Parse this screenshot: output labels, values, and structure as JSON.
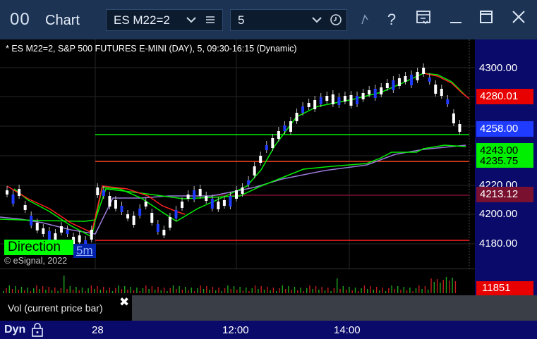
{
  "window": {
    "logo": "00",
    "title": "Chart",
    "symbol_value": "ES M22=2",
    "interval_value": "5",
    "buttons": [
      "bookmark-icon",
      "help-icon",
      "template-icon",
      "minimize-icon",
      "maximize-icon",
      "close-icon"
    ]
  },
  "chart": {
    "title": "* ES M22=2, S&P 500 FUTURES E-MINI (DAY), 5, 09:30-16:15 (Dynamic)",
    "direction_label": "Direction",
    "direction_tail": "5m",
    "copyright": "© eSignal, 2022",
    "colors": {
      "up_candle": "#ffffff",
      "down_candle": "#1f3bff",
      "red_line": "#ff2020",
      "green_line": "#00ee00",
      "purple_line": "#9a7ad8",
      "maroon_line": "#7a1030"
    }
  },
  "price_axis": {
    "ticks": [
      "4300.00",
      "4220.00",
      "4200.00",
      "4180.00"
    ],
    "tags": [
      {
        "label": "4280.01",
        "bg": "#e80000",
        "fg": "#ffffff"
      },
      {
        "label": "4258.00",
        "bg": "#1f3bff",
        "fg": "#ffffff"
      },
      {
        "label": "4235.75",
        "bg": "#00ee00",
        "fg": "#000000"
      },
      {
        "label": "4243.00",
        "bg": "#00ee00",
        "fg": "#000000"
      },
      {
        "label": "4213.12",
        "bg": "#7a1030",
        "fg": "#ffffff"
      }
    ]
  },
  "volume": {
    "caption": "Vol (current price bar)",
    "last": "11851"
  },
  "time_axis": {
    "mode": "Dyn",
    "ticks": [
      "28",
      "12:00",
      "14:00"
    ]
  }
}
